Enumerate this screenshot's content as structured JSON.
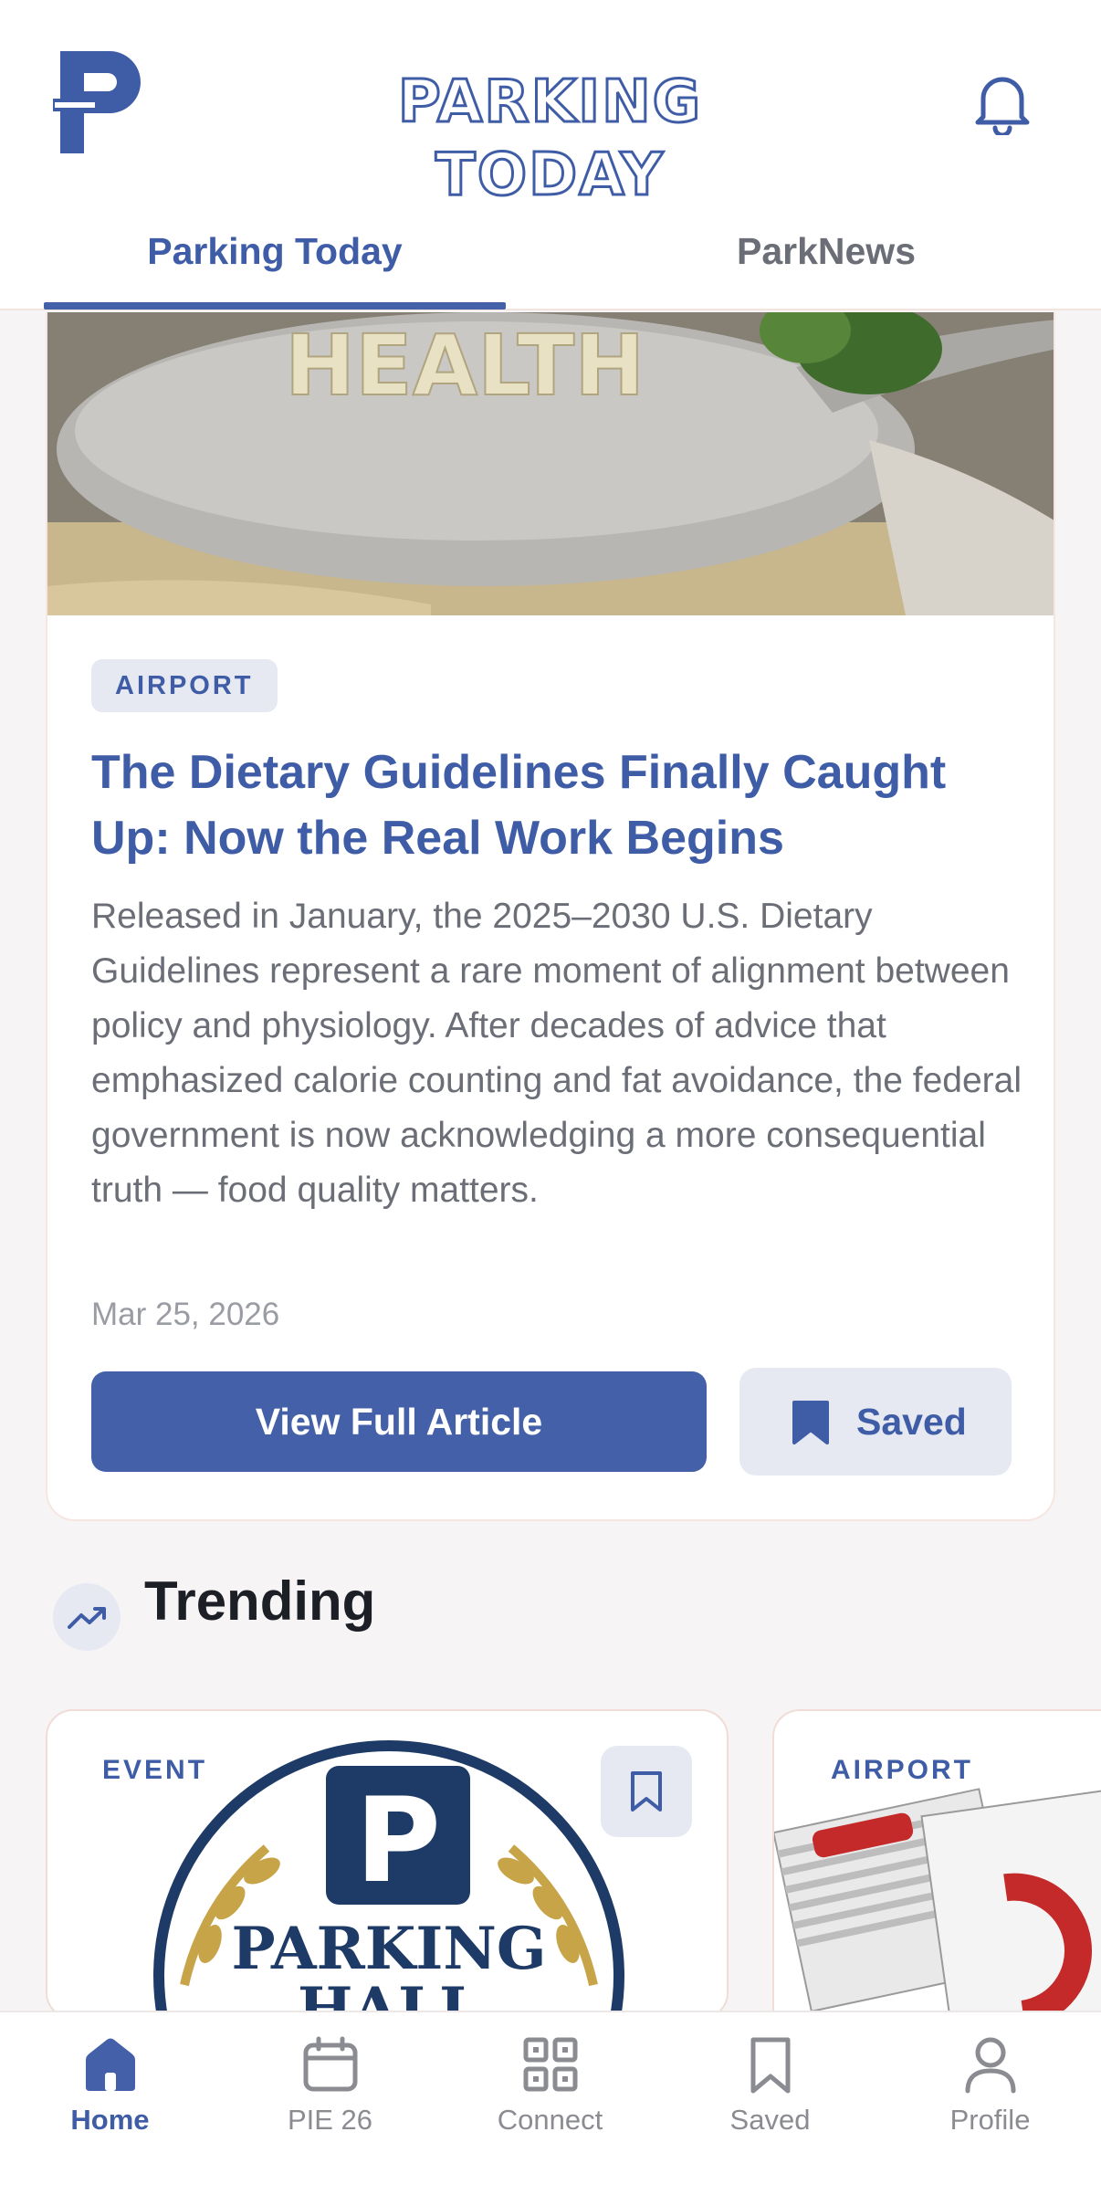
{
  "header": {
    "brand": "PARKING TODAY",
    "tabs": [
      {
        "label": "Parking Today",
        "active": true
      },
      {
        "label": "ParkNews",
        "active": false
      }
    ]
  },
  "feature": {
    "hero_text": "HEALTH",
    "category": "AIRPORT",
    "title": "The Dietary Guidelines Finally Caught Up: Now the Real Work Begins",
    "excerpt": "Released in January, the 2025–2030 U.S. Dietary Guidelines represent a rare moment of alignment between policy and physiology. After decades of advice that emphasized calorie counting and fat avoidance, the federal government is now acknowledging a more consequential truth — food quality matters.",
    "date": "Mar 25, 2026",
    "primary_button": "View Full Article",
    "saved_button": "Saved"
  },
  "trending": {
    "title": "Trending",
    "cards": [
      {
        "category": "EVENT",
        "image_text_1": "PARKING",
        "image_text_2": "HALL"
      },
      {
        "category": "AIRPORT"
      }
    ]
  },
  "bottom_nav": [
    {
      "label": "Home",
      "icon": "home-icon",
      "active": true
    },
    {
      "label": "PIE 26",
      "icon": "calendar-icon",
      "active": false
    },
    {
      "label": "Connect",
      "icon": "grid-icon",
      "active": false
    },
    {
      "label": "Saved",
      "icon": "bookmark-icon",
      "active": false
    },
    {
      "label": "Profile",
      "icon": "person-icon",
      "active": false
    }
  ],
  "colors": {
    "accent": "#4360a8",
    "accent_soft": "#e6e9f1",
    "text_muted": "#6b6e76",
    "background": "#f6f4f4"
  }
}
